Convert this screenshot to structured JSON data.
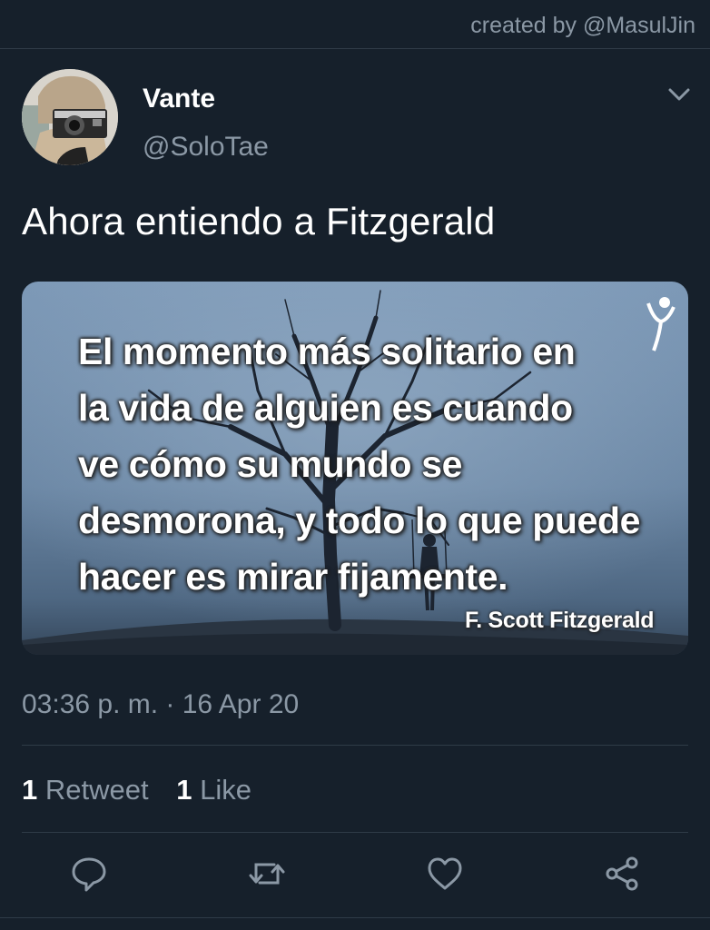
{
  "watermark": "created by @MasulJin",
  "author": {
    "name": "Vante",
    "handle": "@SoloTae"
  },
  "tweet": {
    "text": "Ahora entiendo a Fitzgerald"
  },
  "media": {
    "quote_lines": [
      "El momento más solitario en",
      "la vida de alguien es cuando",
      "ve cómo su mundo se",
      "desmorona, y todo lo que puede",
      "hacer es mirar fijamente."
    ],
    "attribution": "F. Scott Fitzgerald"
  },
  "meta": {
    "timestamp": "03:36 p. m. · 16 Apr 20"
  },
  "stats": {
    "retweets_count": "1",
    "retweets_label": "Retweet",
    "likes_count": "1",
    "likes_label": "Like"
  },
  "actions": [
    "reply-icon",
    "retweet-icon",
    "like-icon",
    "share-icon"
  ],
  "colors": {
    "background": "#16202b",
    "secondary_text": "#8b98a5",
    "divider": "#2f3b47"
  }
}
